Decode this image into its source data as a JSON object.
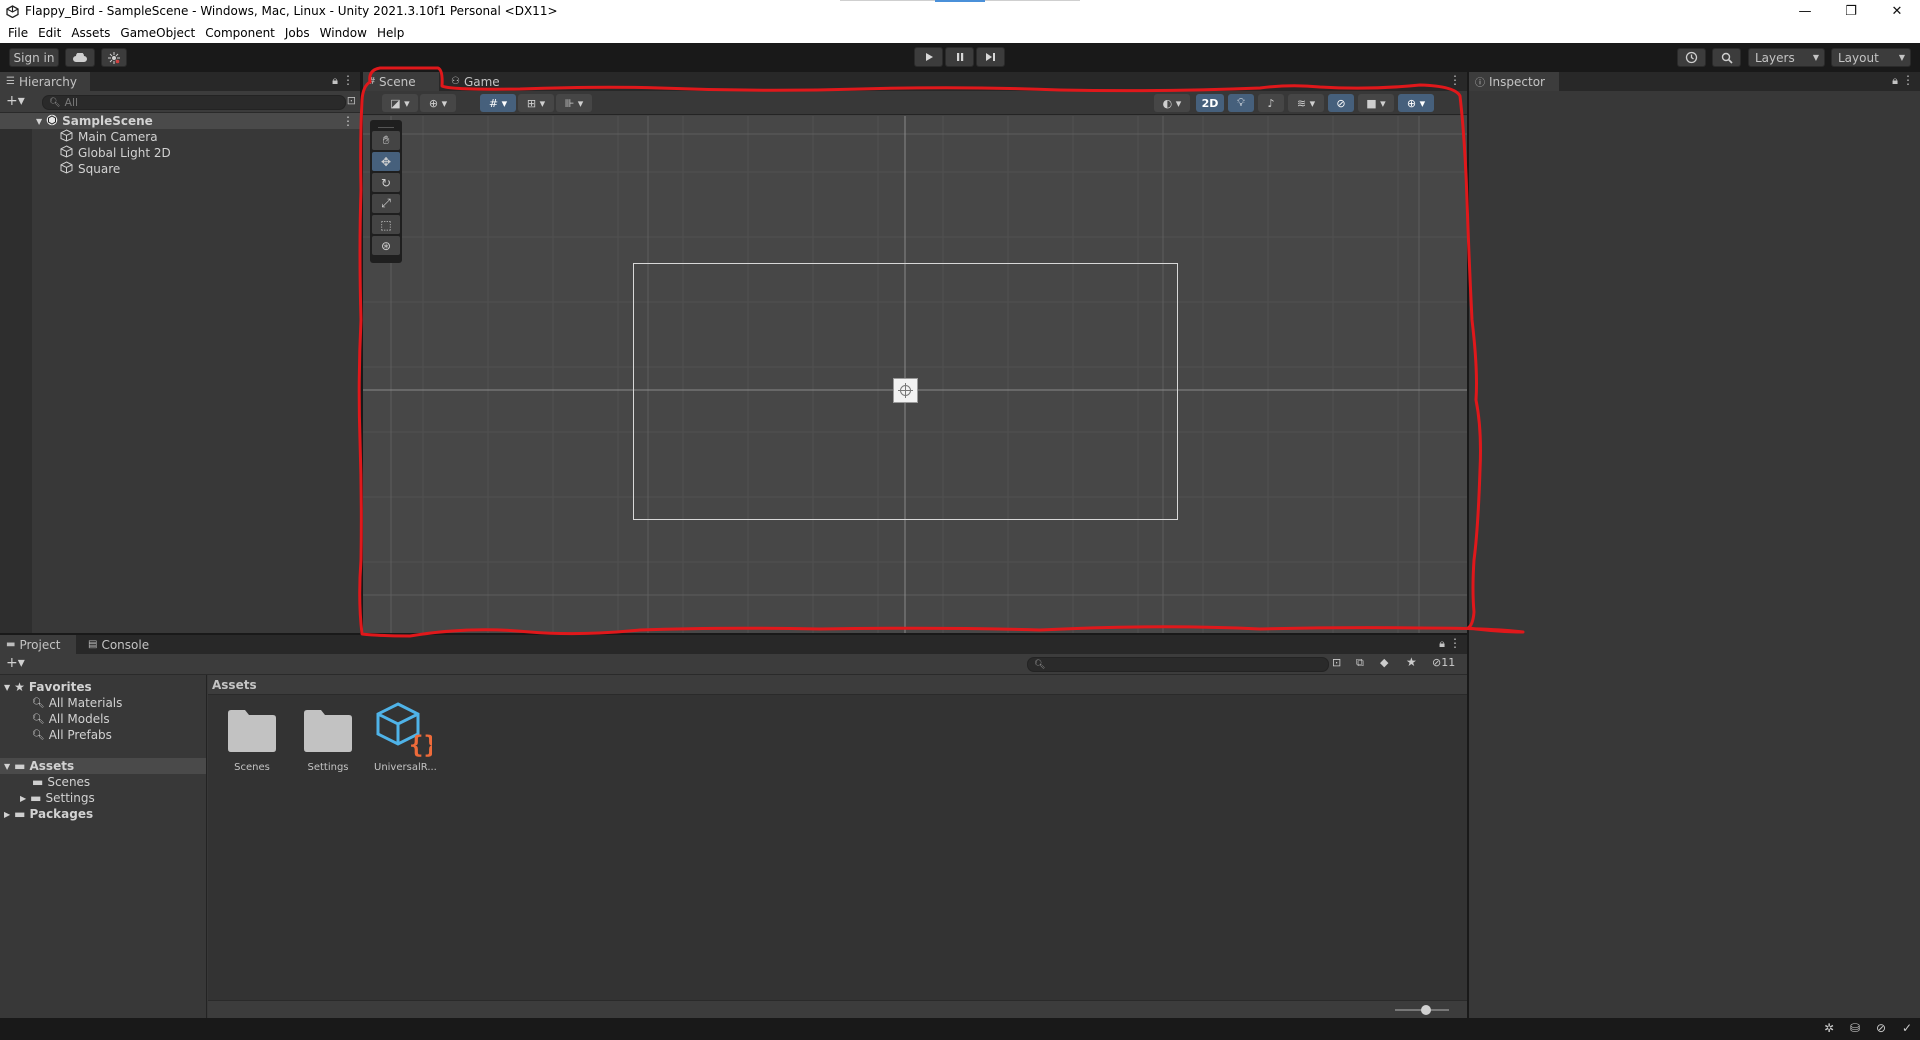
{
  "window": {
    "title": "Flappy_Bird - SampleScene - Windows, Mac, Linux - Unity 2021.3.10f1 Personal <DX11>",
    "minimize": "—",
    "restore": "❐",
    "close": "✕"
  },
  "menu": [
    "File",
    "Edit",
    "Assets",
    "GameObject",
    "Component",
    "Jobs",
    "Window",
    "Help"
  ],
  "toolbar": {
    "sign_in": "Sign in",
    "layers": "Layers",
    "layout": "Layout"
  },
  "hierarchy": {
    "tab": "Hierarchy",
    "search_placeholder": "All",
    "scene": "SampleScene",
    "objects": [
      "Main Camera",
      "Global Light 2D",
      "Square"
    ]
  },
  "scene_view": {
    "tabs": [
      "Scene",
      "Game"
    ],
    "mode_2d": "2D"
  },
  "inspector": {
    "tab": "Inspector"
  },
  "project": {
    "tabs": [
      "Project",
      "Console"
    ],
    "favorites_label": "Favorites",
    "favorites": [
      "All Materials",
      "All Models",
      "All Prefabs"
    ],
    "assets_label": "Assets",
    "asset_folders": [
      "Scenes",
      "Settings"
    ],
    "packages_label": "Packages",
    "breadcrumb": "Assets",
    "items": [
      "Scenes",
      "Settings",
      "UniversalR..."
    ],
    "hidden_count": "11"
  },
  "colors": {
    "annotation_red": "#e0181b",
    "accent_blue": "#46607c"
  }
}
